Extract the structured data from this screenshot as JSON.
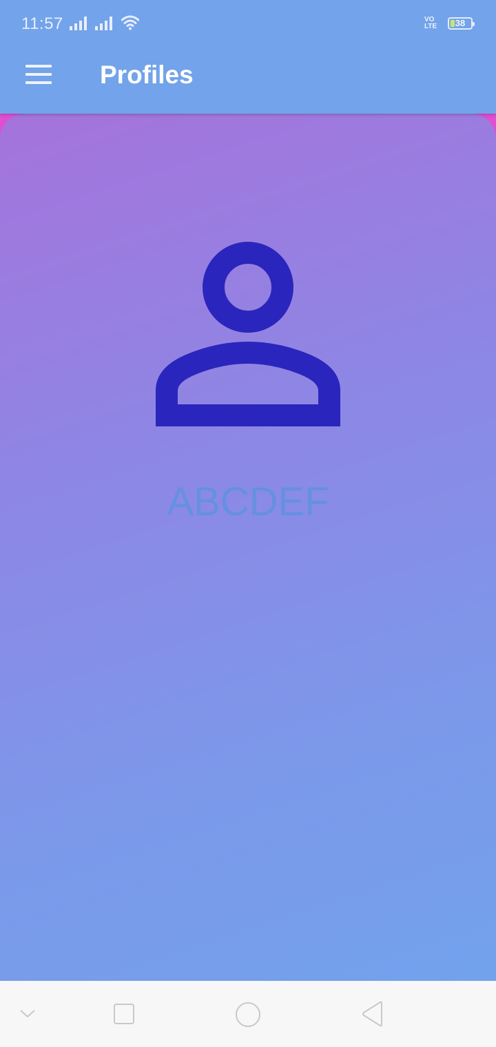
{
  "status_bar": {
    "time": "11:57",
    "network": "VoLTE",
    "battery": "38",
    "icons": [
      "signal-icon",
      "signal-icon",
      "wifi-icon",
      "volte-icon",
      "battery-icon"
    ]
  },
  "header": {
    "title": "Profiles",
    "menu_icon": "hamburger-menu-icon",
    "background_color": "#73a3ea"
  },
  "profile": {
    "name": "ABCDEF",
    "avatar_icon": "person-outline-icon",
    "avatar_color": "#2a25bd",
    "name_color": "#6690e2"
  },
  "nav_bar": {
    "buttons": [
      "collapse-chevron-icon",
      "recent-apps-icon",
      "home-icon",
      "back-icon"
    ]
  },
  "colors": {
    "card_gradient_top": "#a573db",
    "card_gradient_bottom": "#72a2ec",
    "card_edge": "#de4fd2"
  }
}
